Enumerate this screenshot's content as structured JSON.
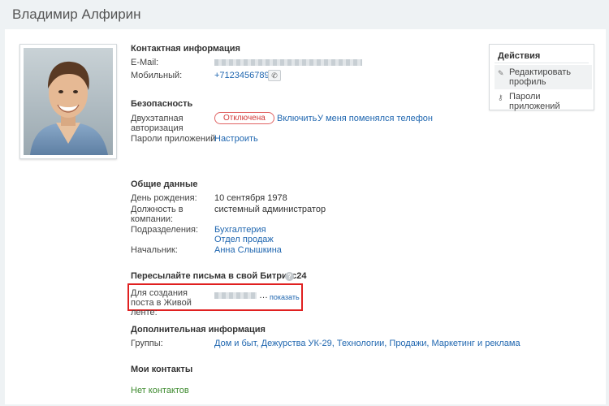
{
  "page": {
    "title": "Владимир Алфирин"
  },
  "contact": {
    "title": "Контактная информация",
    "email_label": "E-Mail:",
    "mobile_label": "Мобильный:",
    "mobile_value": "+71234567890"
  },
  "security": {
    "title": "Безопасность",
    "twofa_label": "Двухэтапная авторизация",
    "twofa_status": "Отключена",
    "enable_link": "Включить",
    "phone_changed_link": "У меня поменялся телефон",
    "app_passwords_label": "Пароли приложений",
    "configure_link": "Настроить"
  },
  "general": {
    "title": "Общие данные",
    "birthday_label": "День рождения:",
    "birthday_value": "10 сентября 1978",
    "position_label": "Должность в компании:",
    "position_value": "системный администратор",
    "departments_label": "Подразделения:",
    "departments": [
      "Бухгалтерия",
      "Отдел продаж"
    ],
    "manager_label": "Начальник:",
    "manager_value": "Анна Слышкина"
  },
  "forward": {
    "title": "Пересылайте письма в свой Битрикс24",
    "help": "?",
    "post_label": "Для создания поста в Живой ленте:",
    "ellipsis": "…",
    "show_link": "показать"
  },
  "extra": {
    "title": "Дополнительная информация",
    "groups_label": "Группы:",
    "groups": "Дом и быт, Дежурства УК-29, Технологии, Продажи, Маркетинг и реклама"
  },
  "contacts": {
    "title": "Мои контакты",
    "empty": "Нет контактов"
  },
  "actions": {
    "title": "Действия",
    "edit_profile": "Редактировать профиль",
    "app_passwords": "Пароли приложений",
    "edit_icon": "pencil-icon",
    "key_icon": "key-icon"
  },
  "colors": {
    "link": "#2067b0",
    "status_off": "#d23b3b",
    "highlight_box": "#e02020",
    "empty_text": "#3d8a2e"
  }
}
